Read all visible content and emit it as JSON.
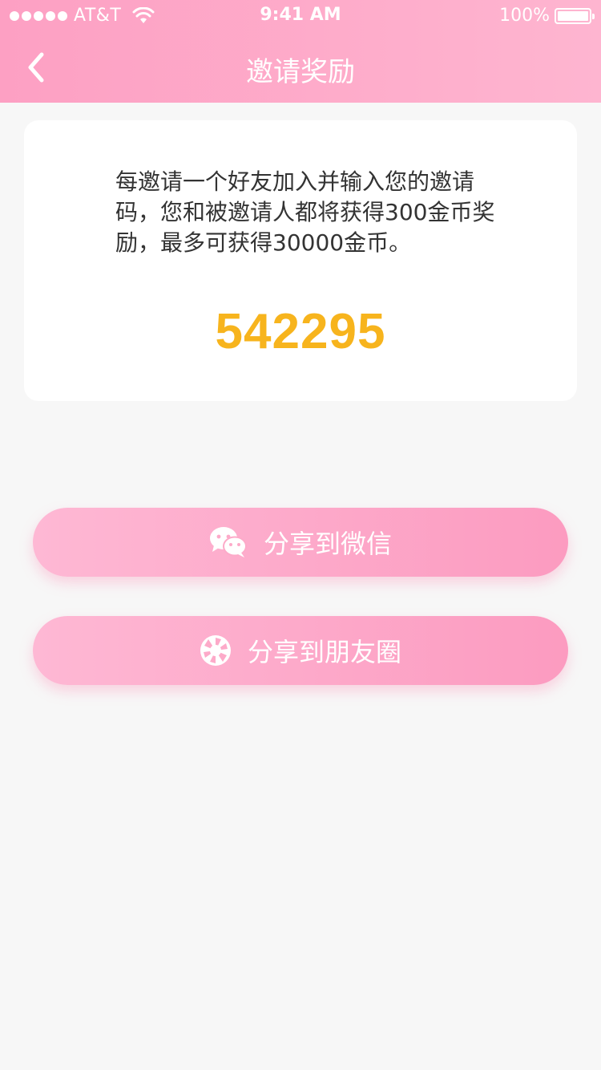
{
  "status_bar": {
    "carrier": "AT&T",
    "time": "9:41 AM",
    "battery": "100%",
    "icons": [
      "signal-dots",
      "wifi-icon",
      "battery-icon"
    ]
  },
  "nav": {
    "title": "邀请奖励",
    "back_icon": "chevron-left-icon"
  },
  "card": {
    "description": "每邀请一个好友加入并输入您的邀请码，您和被邀请人都将获得300金币奖励，最多可获得30000金币。",
    "invite_code": "542295"
  },
  "buttons": {
    "wechat": {
      "label": "分享到微信",
      "icon": "wechat-icon"
    },
    "moments": {
      "label": "分享到朋友圈",
      "icon": "moments-shutter-icon"
    }
  },
  "colors": {
    "header_gradient_start": "#fda0c3",
    "header_gradient_end": "#feb5d0",
    "code_color": "#f7b41d",
    "text_color": "#333333",
    "background": "#f7f7f7"
  }
}
